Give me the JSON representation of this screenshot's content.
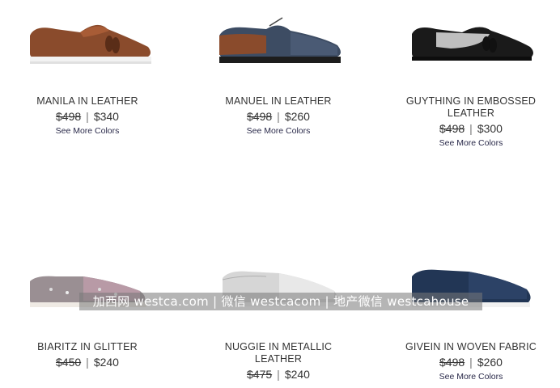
{
  "products": [
    {
      "name": "MANILA IN LEATHER",
      "orig_price": "$498",
      "sale_price": "$340",
      "more": "See More Colors"
    },
    {
      "name": "MANUEL IN LEATHER",
      "orig_price": "$498",
      "sale_price": "$260",
      "more": "See More Colors"
    },
    {
      "name": "GUYTHING IN EMBOSSED LEATHER",
      "orig_price": "$498",
      "sale_price": "$300",
      "more": "See More Colors"
    },
    {
      "name": "BIARITZ IN GLITTER",
      "orig_price": "$450",
      "sale_price": "$240",
      "more": ""
    },
    {
      "name": "NUGGIE IN METALLIC LEATHER",
      "orig_price": "$475",
      "sale_price": "$240",
      "more": ""
    },
    {
      "name": "GIVEIN IN WOVEN FABRIC",
      "orig_price": "$498",
      "sale_price": "$260",
      "more": "See More Colors"
    }
  ],
  "separator": "|",
  "watermark": "加西网 westca.com | 微信 westcacom | 地产微信 westcahouse",
  "icons": [
    "brown-tassel-loafer-icon",
    "denim-oxford-icon",
    "black-white-tassel-loafer-icon",
    "glitter-slip-on-icon",
    "silver-slip-on-icon",
    "navy-slip-on-icon"
  ]
}
